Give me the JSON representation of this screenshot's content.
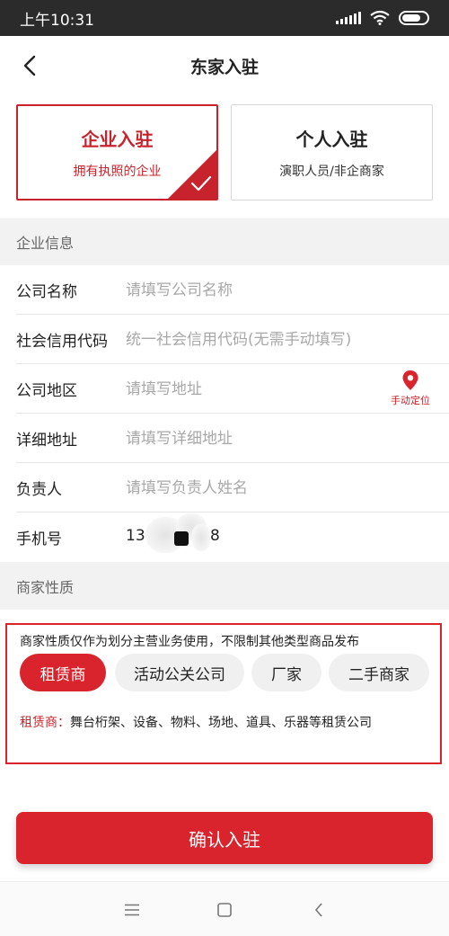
{
  "status_bar": {
    "time": "上午10:31"
  },
  "nav": {
    "title": "东家入驻"
  },
  "account_types": [
    {
      "title": "企业入驻",
      "subtitle": "拥有执照的企业",
      "selected": true
    },
    {
      "title": "个人入驻",
      "subtitle": "演职人员/非企商家",
      "selected": false
    }
  ],
  "sections": {
    "company_info": "企业信息",
    "merchant_type": "商家性质"
  },
  "form": {
    "company_name": {
      "label": "公司名称",
      "placeholder": "请填写公司名称",
      "value": ""
    },
    "credit_code": {
      "label": "社会信用代码",
      "placeholder": "统一社会信用代码(无需手动填写)",
      "value": ""
    },
    "region": {
      "label": "公司地区",
      "placeholder": "请填写地址",
      "value": ""
    },
    "address": {
      "label": "详细地址",
      "placeholder": "请填写详细地址",
      "value": ""
    },
    "contact": {
      "label": "负责人",
      "placeholder": "请填写负责人姓名",
      "value": ""
    },
    "phone": {
      "label": "手机号",
      "value_prefix": "13",
      "value_suffix": "8"
    },
    "locate_label": "手动定位"
  },
  "merchant": {
    "note": "商家性质仅作为划分主营业务使用，不限制其他类型商品发布",
    "options": [
      {
        "label": "租赁商",
        "selected": true
      },
      {
        "label": "活动公关公司",
        "selected": false
      },
      {
        "label": "厂家",
        "selected": false
      },
      {
        "label": "二手商家",
        "selected": false
      }
    ],
    "desc_key": "租赁商：",
    "desc_text": "舞台桁架、设备、物料、场地、道具、乐器等租赁公司"
  },
  "confirm_button": "确认入驻",
  "icons": {
    "back": "chevron-left-icon",
    "check": "check-icon",
    "location": "location-pin-icon",
    "menu": "menu-icon",
    "home": "home-square-icon",
    "sys_back": "sys-back-icon"
  },
  "colors": {
    "accent": "#d9242d",
    "accent_text": "#c8232c",
    "section_bg": "#f2f2f2",
    "status_bar": "#2b2b2b"
  }
}
